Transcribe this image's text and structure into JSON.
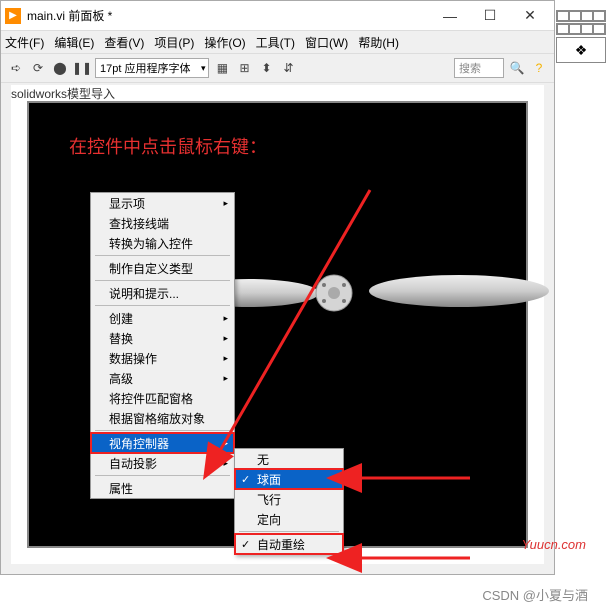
{
  "titlebar": {
    "title": "main.vi 前面板 *"
  },
  "menubar": {
    "items": [
      "文件(F)",
      "编辑(E)",
      "查看(V)",
      "项目(P)",
      "操作(O)",
      "工具(T)",
      "窗口(W)",
      "帮助(H)"
    ]
  },
  "toolbar": {
    "font": "17pt 应用程序字体",
    "search_placeholder": "搜索"
  },
  "canvas": {
    "label": "solidworks模型导入",
    "instruction": "在控件中点击鼠标右键："
  },
  "context_menu": {
    "items": [
      {
        "label": "显示项",
        "sub": true
      },
      {
        "label": "查找接线端"
      },
      {
        "label": "转换为输入控件"
      },
      {
        "sep": true
      },
      {
        "label": "制作自定义类型"
      },
      {
        "sep": true
      },
      {
        "label": "说明和提示..."
      },
      {
        "sep": true
      },
      {
        "label": "创建",
        "sub": true
      },
      {
        "label": "替换",
        "sub": true
      },
      {
        "label": "数据操作",
        "sub": true
      },
      {
        "label": "高级",
        "sub": true
      },
      {
        "label": "将控件匹配窗格"
      },
      {
        "label": "根据窗格缩放对象"
      },
      {
        "sep": true
      },
      {
        "label": "视角控制器",
        "sub": true,
        "hl": true
      },
      {
        "label": "自动投影",
        "sub": true
      },
      {
        "sep": true
      },
      {
        "label": "属性"
      }
    ]
  },
  "sub_menu": {
    "items": [
      {
        "label": "无"
      },
      {
        "label": "球面",
        "chk": true,
        "hl": true
      },
      {
        "label": "飞行"
      },
      {
        "label": "定向"
      },
      {
        "sep": true
      },
      {
        "label": "自动重绘",
        "chk": true,
        "box": true
      }
    ]
  },
  "watermarks": {
    "w1": "Yuucn.com",
    "w2": "CSDN @小夏与酒"
  }
}
